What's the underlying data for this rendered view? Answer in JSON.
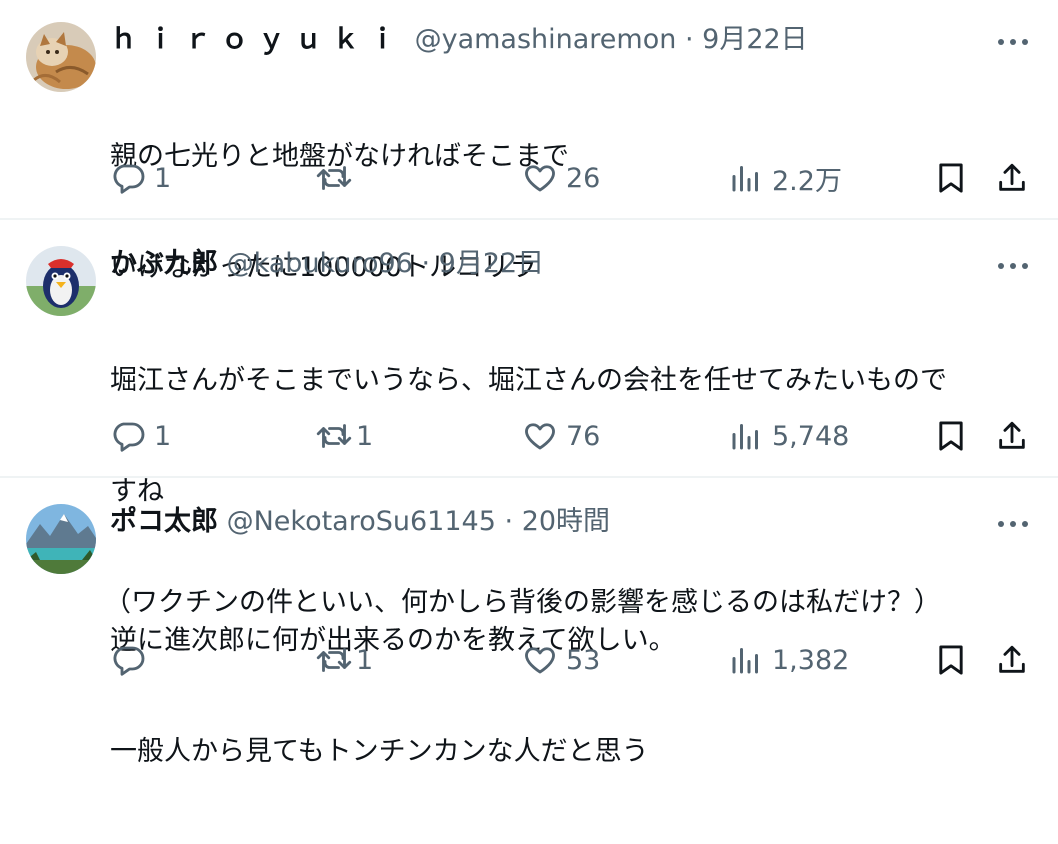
{
  "tweets": [
    {
      "display_name": "ｈｉｒｏｙｕｋｉ",
      "handle": "@yamashinaremon",
      "separator": "·",
      "time": "9月22日",
      "lines": [
        "親の七光りと地盤がなければそこまで",
        "いけなかったに100000トルコリラ"
      ],
      "replies": "1",
      "retweets": "",
      "likes": "26",
      "views": "2.2万",
      "avatar_icon": "cat-avatar"
    },
    {
      "display_name": "かぶ九郎",
      "handle": "@kabukuro96",
      "separator": "·",
      "time": "9月22日",
      "lines": [
        "堀江さんがそこまでいうなら、堀江さんの会社を任せてみたいもので",
        "すね",
        "（ワクチンの件といい、何かしら背後の影響を感じるのは私だけ？）"
      ],
      "replies": "1",
      "retweets": "1",
      "likes": "76",
      "views": "5,748",
      "avatar_icon": "penguin-avatar"
    },
    {
      "display_name": "ポコ太郎",
      "handle": "@NekotaroSu61145",
      "separator": "·",
      "time": "20時間",
      "lines": [
        "逆に進次郎に何が出来るのかを教えて欲しい。",
        "一般人から見てもトンチンカンな人だと思う"
      ],
      "replies": "",
      "retweets": "1",
      "likes": "53",
      "views": "1,382",
      "avatar_icon": "mountain-lake-avatar"
    }
  ],
  "colors": {
    "text": "#0f1419",
    "secondary": "#536471",
    "separator": "#eff3f4"
  }
}
